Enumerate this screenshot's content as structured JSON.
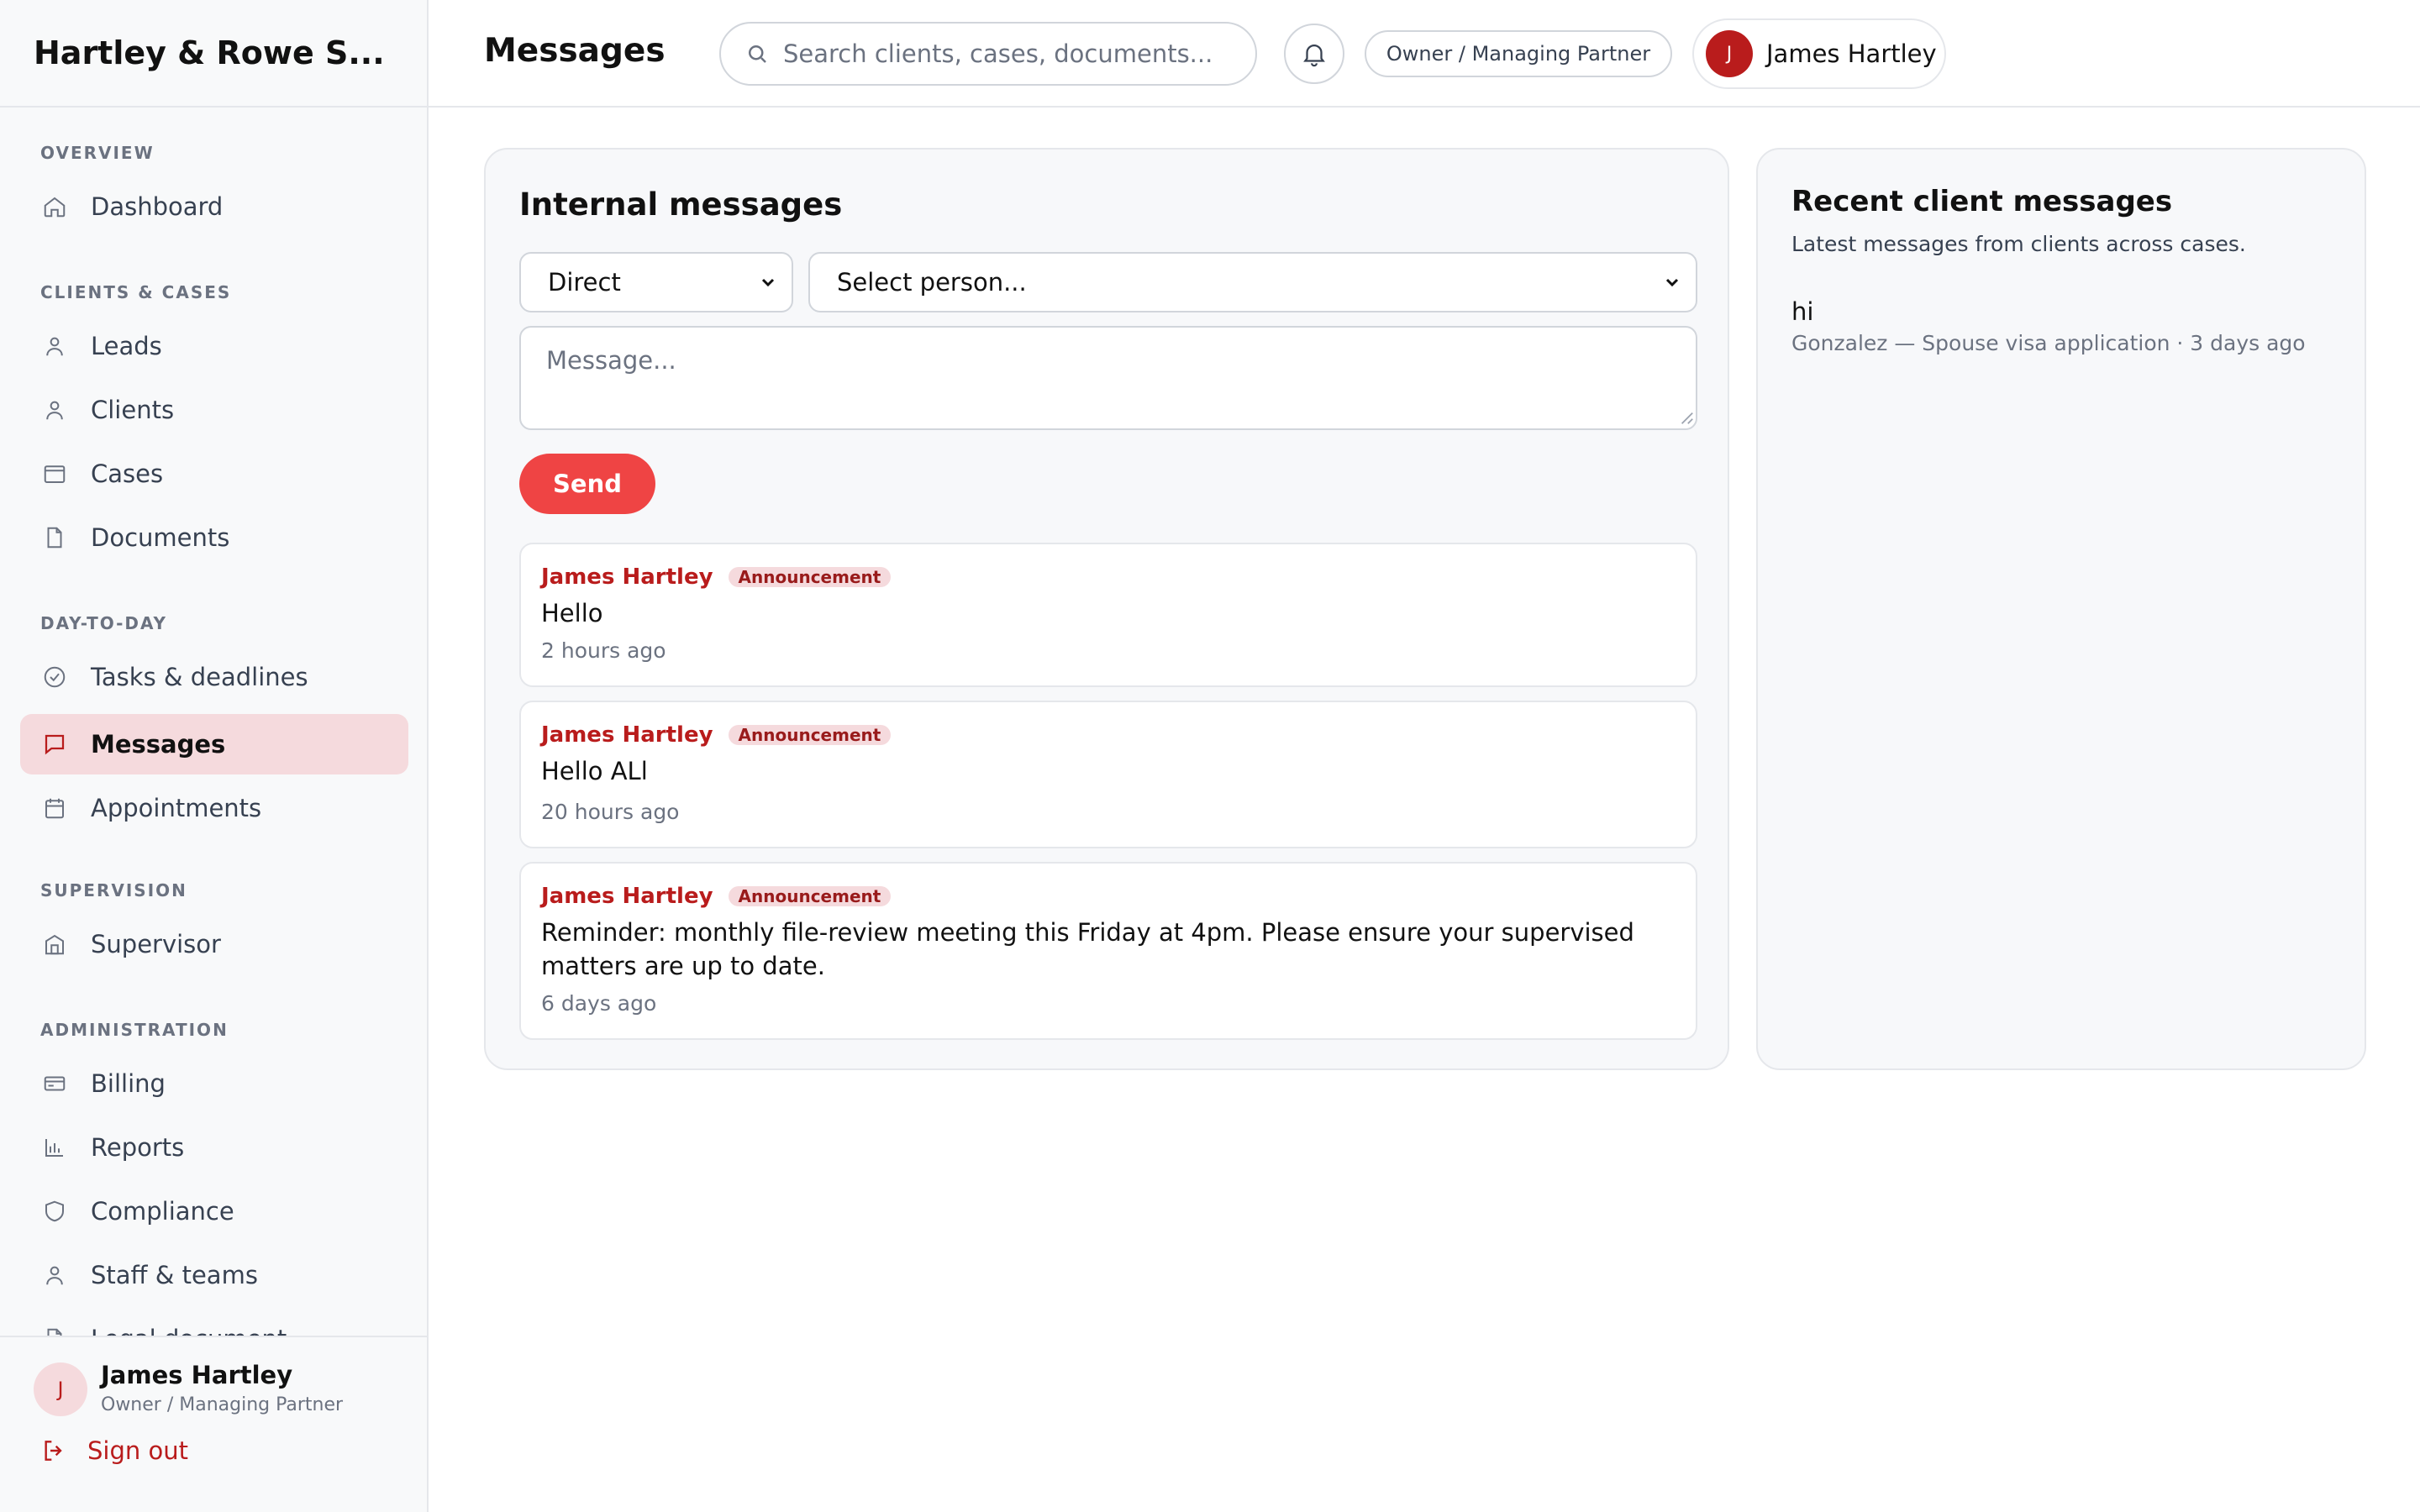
{
  "brand": "Hartley & Rowe S...",
  "sidebar": {
    "sections": [
      {
        "label": "OVERVIEW"
      },
      {
        "label": "CLIENTS & CASES"
      },
      {
        "label": "DAY-TO-DAY"
      },
      {
        "label": "SUPERVISION"
      },
      {
        "label": "ADMINISTRATION"
      }
    ],
    "items": [
      {
        "label": "Dashboard",
        "icon": "home-icon"
      },
      {
        "label": "Leads",
        "icon": "user-icon"
      },
      {
        "label": "Clients",
        "icon": "user-icon"
      },
      {
        "label": "Cases",
        "icon": "folder-icon"
      },
      {
        "label": "Documents",
        "icon": "document-icon"
      },
      {
        "label": "Tasks & deadlines",
        "icon": "check-circle-icon"
      },
      {
        "label": "Messages",
        "icon": "chat-icon"
      },
      {
        "label": "Appointments",
        "icon": "calendar-icon"
      },
      {
        "label": "Supervisor",
        "icon": "building-icon"
      },
      {
        "label": "Billing",
        "icon": "card-icon"
      },
      {
        "label": "Reports",
        "icon": "bar-chart-icon"
      },
      {
        "label": "Compliance",
        "icon": "shield-icon"
      },
      {
        "label": "Staff & teams",
        "icon": "user-icon"
      },
      {
        "label": "Legal document...",
        "icon": "document-icon"
      }
    ],
    "active_item": "Messages",
    "footer": {
      "avatar_initial": "J",
      "name": "James Hartley",
      "role": "Owner / Managing Partner",
      "signout_label": "Sign out"
    }
  },
  "header": {
    "title": "Messages",
    "search_placeholder": "Search clients, cases, documents...",
    "role_label": "Owner / Managing Partner",
    "user_initial": "J",
    "user_name": "James Hartley"
  },
  "internal": {
    "title": "Internal messages",
    "type_select": "Direct",
    "person_select": "Select person...",
    "message_placeholder": "Message...",
    "send_label": "Send",
    "messages": [
      {
        "author": "James Hartley",
        "badge": "Announcement",
        "body": "Hello",
        "time": "2 hours ago"
      },
      {
        "author": "James Hartley",
        "badge": "Announcement",
        "body": "Hello ALl",
        "time": "20 hours ago"
      },
      {
        "author": "James Hartley",
        "badge": "Announcement",
        "body": "Reminder: monthly file-review meeting this Friday at 4pm. Please ensure your supervised matters are up to date.",
        "time": "6 days ago"
      }
    ]
  },
  "client_messages": {
    "title": "Recent client messages",
    "subtitle": "Latest messages from clients across cases.",
    "items": [
      {
        "body": "hi",
        "meta": "Gonzalez — Spouse visa application · 3 days ago"
      }
    ]
  },
  "colors": {
    "accent": "#ef4444",
    "accent_dark": "#b91c1c",
    "active_bg": "#f5dadd"
  }
}
